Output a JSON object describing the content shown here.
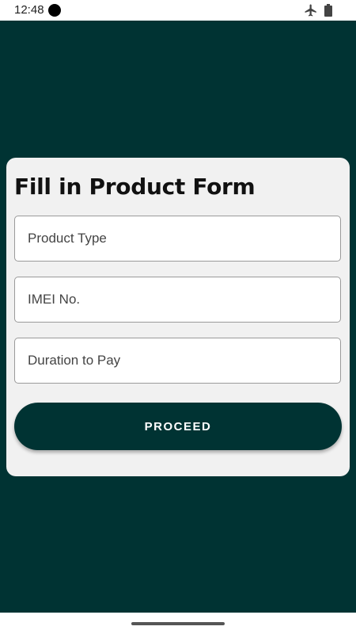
{
  "status_bar": {
    "time": "12:48",
    "icons": [
      "camera-dot-icon",
      "airplane-icon",
      "battery-icon"
    ]
  },
  "form": {
    "title": "Fill in Product Form",
    "fields": [
      {
        "placeholder": "Product Type",
        "value": ""
      },
      {
        "placeholder": "IMEI No.",
        "value": ""
      },
      {
        "placeholder": "Duration to Pay",
        "value": ""
      }
    ],
    "submit_label": "PROCEED"
  },
  "colors": {
    "background": "#003333",
    "card": "#f1f1f1",
    "button": "#003333",
    "button_text": "#ffffff"
  }
}
